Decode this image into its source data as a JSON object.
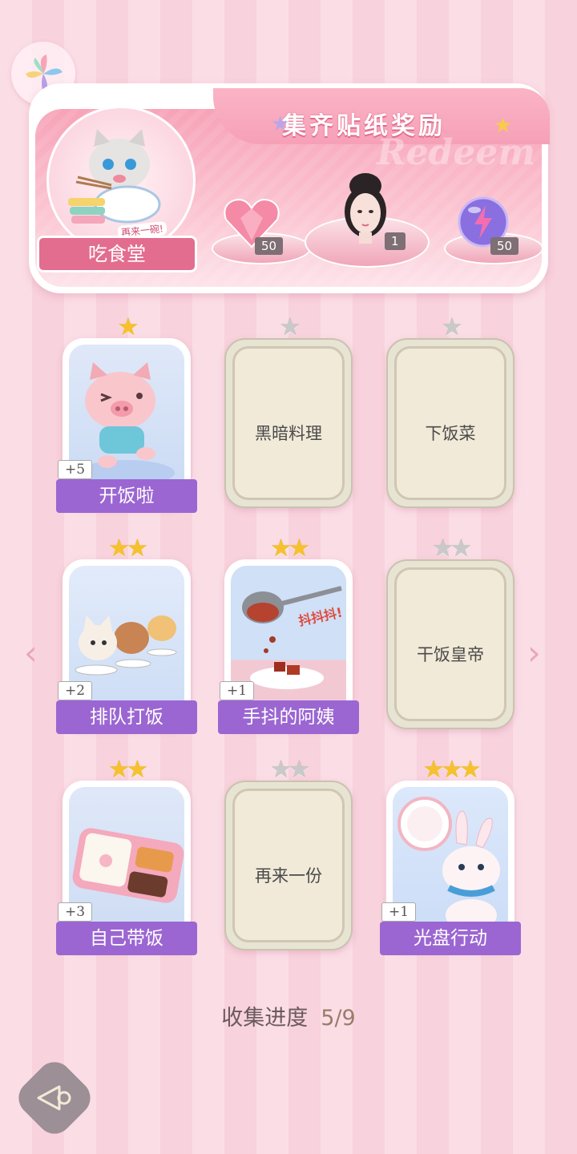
{
  "banner": {
    "title": "集齐贴纸奖励",
    "watermark": "Redeem",
    "canteen_label": "吃食堂",
    "canteen_sticker_text": "再来一碗!",
    "rewards": [
      {
        "icon": "heart-gem-icon",
        "count": "50"
      },
      {
        "icon": "avatar-portrait",
        "count": "1"
      },
      {
        "icon": "lightning-orb-icon",
        "count": "50"
      }
    ]
  },
  "cards": [
    {
      "name": "开饭啦",
      "stars": 1,
      "stars_max": 1,
      "unlocked": true,
      "bonus": "+5",
      "art": "pig-running"
    },
    {
      "name": "黑暗料理",
      "stars": 0,
      "stars_max": 1,
      "unlocked": false
    },
    {
      "name": "下饭菜",
      "stars": 0,
      "stars_max": 1,
      "unlocked": false
    },
    {
      "name": "排队打饭",
      "stars": 2,
      "stars_max": 2,
      "unlocked": true,
      "bonus": "+2",
      "art": "cats-queue"
    },
    {
      "name": "手抖的阿姨",
      "stars": 2,
      "stars_max": 2,
      "unlocked": true,
      "bonus": "+1",
      "art": "ladle-scoop",
      "art_text": "抖抖抖!"
    },
    {
      "name": "干饭皇帝",
      "stars": 0,
      "stars_max": 2,
      "unlocked": false
    },
    {
      "name": "自己带饭",
      "stars": 2,
      "stars_max": 2,
      "unlocked": true,
      "bonus": "+3",
      "art": "bento-box"
    },
    {
      "name": "再来一份",
      "stars": 0,
      "stars_max": 2,
      "unlocked": false
    },
    {
      "name": "光盘行动",
      "stars": 3,
      "stars_max": 3,
      "unlocked": true,
      "bonus": "+1",
      "art": "bunny-plate"
    }
  ],
  "progress": {
    "label": "收集进度",
    "value": "5/9"
  },
  "colors": {
    "accent": "#9b66d2",
    "banner": "#f7a3b8",
    "label_pink": "#e36d8f"
  }
}
